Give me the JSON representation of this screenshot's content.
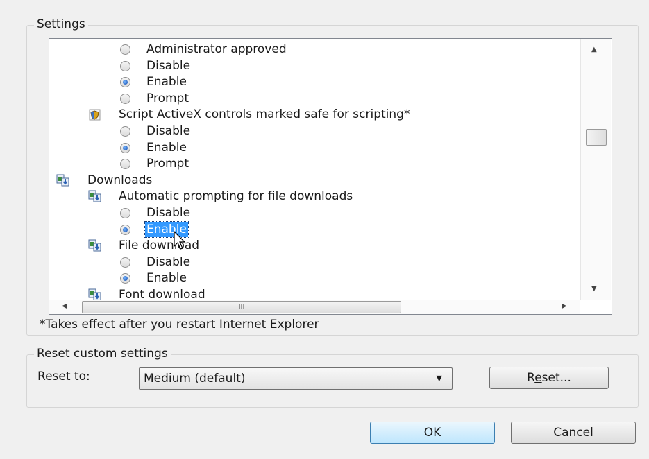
{
  "settings": {
    "group_title": "Settings",
    "rows": [
      {
        "kind": "radio",
        "label": "Administrator approved",
        "checked": false
      },
      {
        "kind": "radio",
        "label": "Disable",
        "checked": false
      },
      {
        "kind": "radio",
        "label": "Enable",
        "checked": true
      },
      {
        "kind": "radio",
        "label": "Prompt",
        "checked": false
      },
      {
        "kind": "section",
        "label": "Script ActiveX controls marked safe for scripting*",
        "icon": "shield-script-icon"
      },
      {
        "kind": "radio",
        "label": "Disable",
        "checked": false
      },
      {
        "kind": "radio",
        "label": "Enable",
        "checked": true
      },
      {
        "kind": "radio",
        "label": "Prompt",
        "checked": false
      },
      {
        "kind": "category",
        "label": "Downloads",
        "icon": "downloads-icon"
      },
      {
        "kind": "section",
        "label": "Automatic prompting for file downloads",
        "icon": "download-setting-icon"
      },
      {
        "kind": "radio",
        "label": "Disable",
        "checked": false
      },
      {
        "kind": "radio",
        "label": "Enable",
        "checked": true,
        "selected": true
      },
      {
        "kind": "section",
        "label": "File download",
        "icon": "download-setting-icon"
      },
      {
        "kind": "radio",
        "label": "Disable",
        "checked": false
      },
      {
        "kind": "radio",
        "label": "Enable",
        "checked": true
      },
      {
        "kind": "section",
        "label": "Font download",
        "icon": "download-setting-icon"
      }
    ],
    "hscroll_thumb_glyph": "III",
    "note": "*Takes effect after you restart Internet Explorer"
  },
  "reset": {
    "group_title": "Reset custom settings",
    "label_prefix": "R",
    "label_rest": "eset to:",
    "selected_value": "Medium (default)",
    "button_prefix": "R",
    "button_underlined": "e",
    "button_rest": "set..."
  },
  "buttons": {
    "ok": "OK",
    "cancel": "Cancel"
  }
}
